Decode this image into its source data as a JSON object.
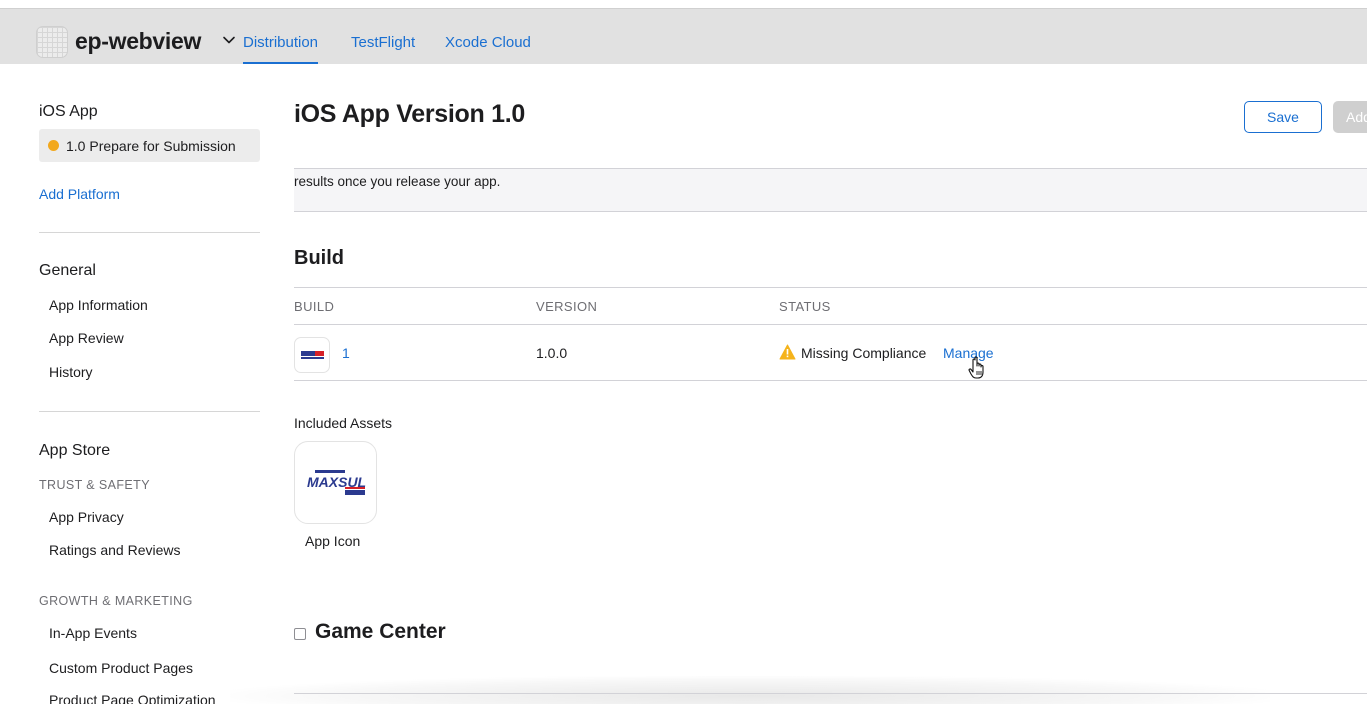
{
  "header": {
    "app_name": "ep-webview",
    "tabs": [
      {
        "label": "Distribution",
        "active": true
      },
      {
        "label": "TestFlight",
        "active": false
      },
      {
        "label": "Xcode Cloud",
        "active": false
      }
    ],
    "accent_color": "#1a6fd1"
  },
  "sidebar": {
    "platform_title": "iOS App",
    "version_pill": {
      "label": "1.0 Prepare for Submission",
      "status_color": "#f2a81d"
    },
    "add_platform": "Add Platform",
    "general": {
      "title": "General",
      "items": [
        "App Information",
        "App Review",
        "History"
      ]
    },
    "app_store": {
      "title": "App Store",
      "categories": [
        {
          "label": "TRUST & SAFETY",
          "items": [
            "App Privacy",
            "Ratings and Reviews"
          ]
        },
        {
          "label": "GROWTH & MARKETING",
          "items": [
            "In-App Events",
            "Custom Product Pages",
            "Product Page Optimization"
          ]
        }
      ]
    }
  },
  "main": {
    "title": "iOS App Version 1.0",
    "save_label": "Save",
    "add_label": "Add",
    "notice": "results once you release your app.",
    "build_section": {
      "title": "Build",
      "columns": [
        "BUILD",
        "VERSION",
        "STATUS"
      ],
      "row": {
        "build": "1",
        "version": "1.0.0",
        "status_icon": "warning-triangle-icon",
        "status": "Missing Compliance",
        "action": "Manage"
      }
    },
    "included_assets": {
      "label": "Included Assets",
      "items": [
        {
          "name": "App Icon",
          "logo_text": "MAXSUL"
        }
      ]
    },
    "game_center": {
      "title": "Game Center",
      "checked": false
    }
  }
}
